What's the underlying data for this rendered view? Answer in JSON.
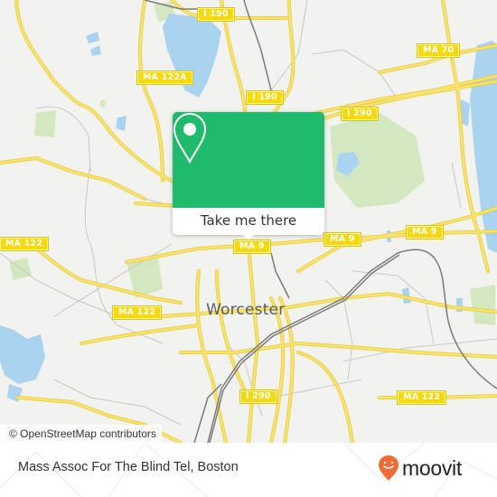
{
  "map": {
    "city_label": "Worcester",
    "attribution": "© OpenStreetMap contributors",
    "shields": [
      {
        "id": "i190-north",
        "label": "I 190"
      },
      {
        "id": "i190-south",
        "label": "I 190"
      },
      {
        "id": "ma122a",
        "label": "MA 122A"
      },
      {
        "id": "ma70",
        "label": "MA 70"
      },
      {
        "id": "i290-north",
        "label": "I 290"
      },
      {
        "id": "ma122-west",
        "label": "MA 122"
      },
      {
        "id": "ma122-mid",
        "label": "MA 122"
      },
      {
        "id": "ma9-center",
        "label": "MA 9"
      },
      {
        "id": "ma9-east",
        "label": "MA 9"
      },
      {
        "id": "ma9-far-east",
        "label": "MA 9"
      },
      {
        "id": "i290-south",
        "label": "I 290"
      },
      {
        "id": "ma122-east",
        "label": "MA 122"
      }
    ],
    "colors": {
      "background": "#f2f2ef",
      "water": "#a9d3ee",
      "park": "#d3e8c0",
      "road": "#f5dd5a",
      "rail": "#777777"
    }
  },
  "popup": {
    "icon": "map-pin-icon",
    "button_label": "Take me there",
    "accent_color": "#1fba6b"
  },
  "footer": {
    "title": "Mass Assoc For The Blind Tel, Boston",
    "brand": "moovit",
    "brand_icon": "moovit-smiley-pin-icon",
    "brand_color": "#f26b34"
  }
}
